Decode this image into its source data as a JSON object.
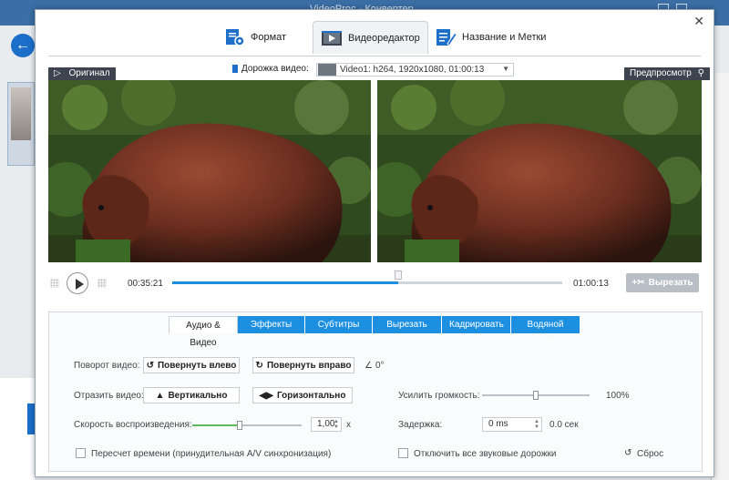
{
  "background": {
    "window_title": "VideoProc - Конвертер"
  },
  "dialog": {
    "tabs": [
      {
        "label": "Формат"
      },
      {
        "label": "Видеоредактор",
        "active": true
      },
      {
        "label": "Название и Метки"
      }
    ]
  },
  "preview": {
    "original_label": "Оригинал",
    "preview_label": "Предпросмотр",
    "track_label": "Дорожка видео:",
    "track_value": "Video1: h264, 1920x1080, 01:00:13"
  },
  "player": {
    "current_time": "00:35:21",
    "total_time": "01:00:13",
    "progress_fraction": 0.58,
    "cut_button": "Вырезать"
  },
  "settings": {
    "tabs": [
      "Аудио & Видео",
      "Эффекты",
      "Субтитры",
      "Вырезать",
      "Кадрировать",
      "Водяной знак"
    ],
    "rotate_label": "Поворот видео:",
    "rotate_left": "Повернуть влево",
    "rotate_right": "Повернуть вправо",
    "rotation_value": "0°",
    "flip_label": "Отразить видео:",
    "flip_vertical": "Вертикально",
    "flip_horizontal": "Горизонтально",
    "speed_label": "Скорость воспроизведения:",
    "speed_value": "1,00",
    "speed_unit": "x",
    "speed_fraction": 0.43,
    "volume_label": "Усилить громкость:",
    "volume_value": "100%",
    "volume_fraction": 0.5,
    "delay_label": "Задержка:",
    "delay_value": "0 ms",
    "delay_seconds": "0.0 сек",
    "resync_label": "Пересчет времени (принудительная A/V синхронизация)",
    "mute_label": "Отключить все звуковые дорожки",
    "reset_label": "Сброс"
  },
  "colors": {
    "accent": "#1d8fe0",
    "cut_button_disabled": "#b8bec5",
    "label_dark": "#3d4450"
  }
}
